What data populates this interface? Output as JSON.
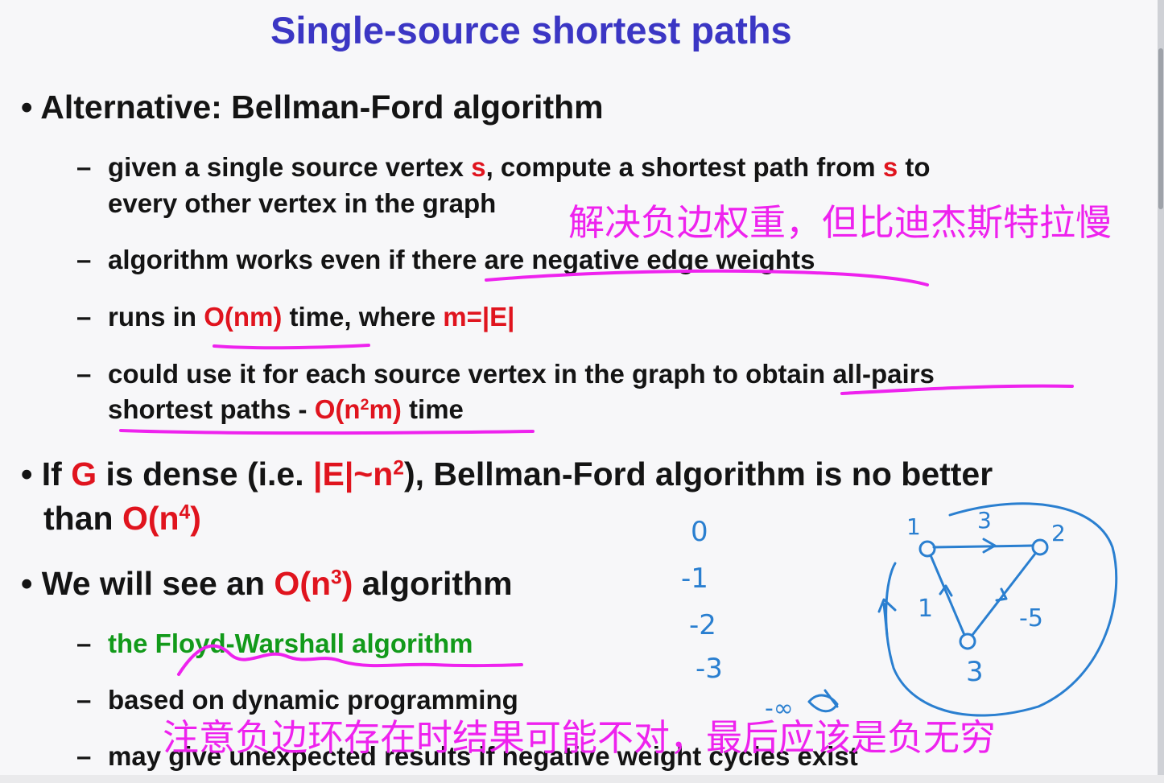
{
  "slide": {
    "title": "Single-source shortest paths",
    "bullet_char": "•",
    "dash_char": "–",
    "b1": {
      "text": "Alternative: Bellman-Ford algorithm",
      "sub1": {
        "a": "given a single source vertex ",
        "s1": "s",
        "b": ", compute a shortest path from ",
        "s2": "s",
        "c": " to",
        "line2": "every other vertex in the graph"
      },
      "sub2": "algorithm works even if there are negative edge weights",
      "sub3": {
        "a": "runs in ",
        "red1": "O(nm)",
        "b": " time, where ",
        "red2": "m=|E|"
      },
      "sub4": {
        "line1": "could use it for each source vertex in the graph to obtain all-pairs",
        "a": "shortest paths - ",
        "red_pre": "O(n",
        "red_sup": "2",
        "red_post": "m)",
        "b": " time"
      }
    },
    "b2": {
      "a": "If ",
      "red1": "G",
      "b": " is dense (i.e. ",
      "red2_pre": "|E|~n",
      "red2_sup": "2",
      "c": "), Bellman-Ford algorithm is no better",
      "line2_a": "than ",
      "red3_pre": "O(n",
      "red3_sup": "4",
      "red3_post": ")"
    },
    "b3": {
      "a": "We will see an ",
      "red_pre": "O(n",
      "red_sup": "3",
      "red_post": ")",
      "b": " algorithm",
      "sub1": "the Floyd-Warshall algorithm",
      "sub2": "based on dynamic programming",
      "sub3": "may give unexpected results if negative weight cycles exist"
    }
  },
  "annotations": {
    "note1": "解决负边权重，但比迪杰斯特拉慢",
    "note2": "注意负边环存在时结果可能不对，最后应该是负无穷",
    "color": "#ee22ee"
  },
  "handwriting": {
    "ink_magenta": "#ee22ee",
    "ink_blue": "#2a7fd0",
    "column": [
      "0",
      "-1",
      "-2",
      "-3",
      "-∞"
    ],
    "vertex_labels": [
      "1",
      "2",
      "3"
    ],
    "edge_weights": [
      "3",
      "1",
      "-5"
    ]
  }
}
